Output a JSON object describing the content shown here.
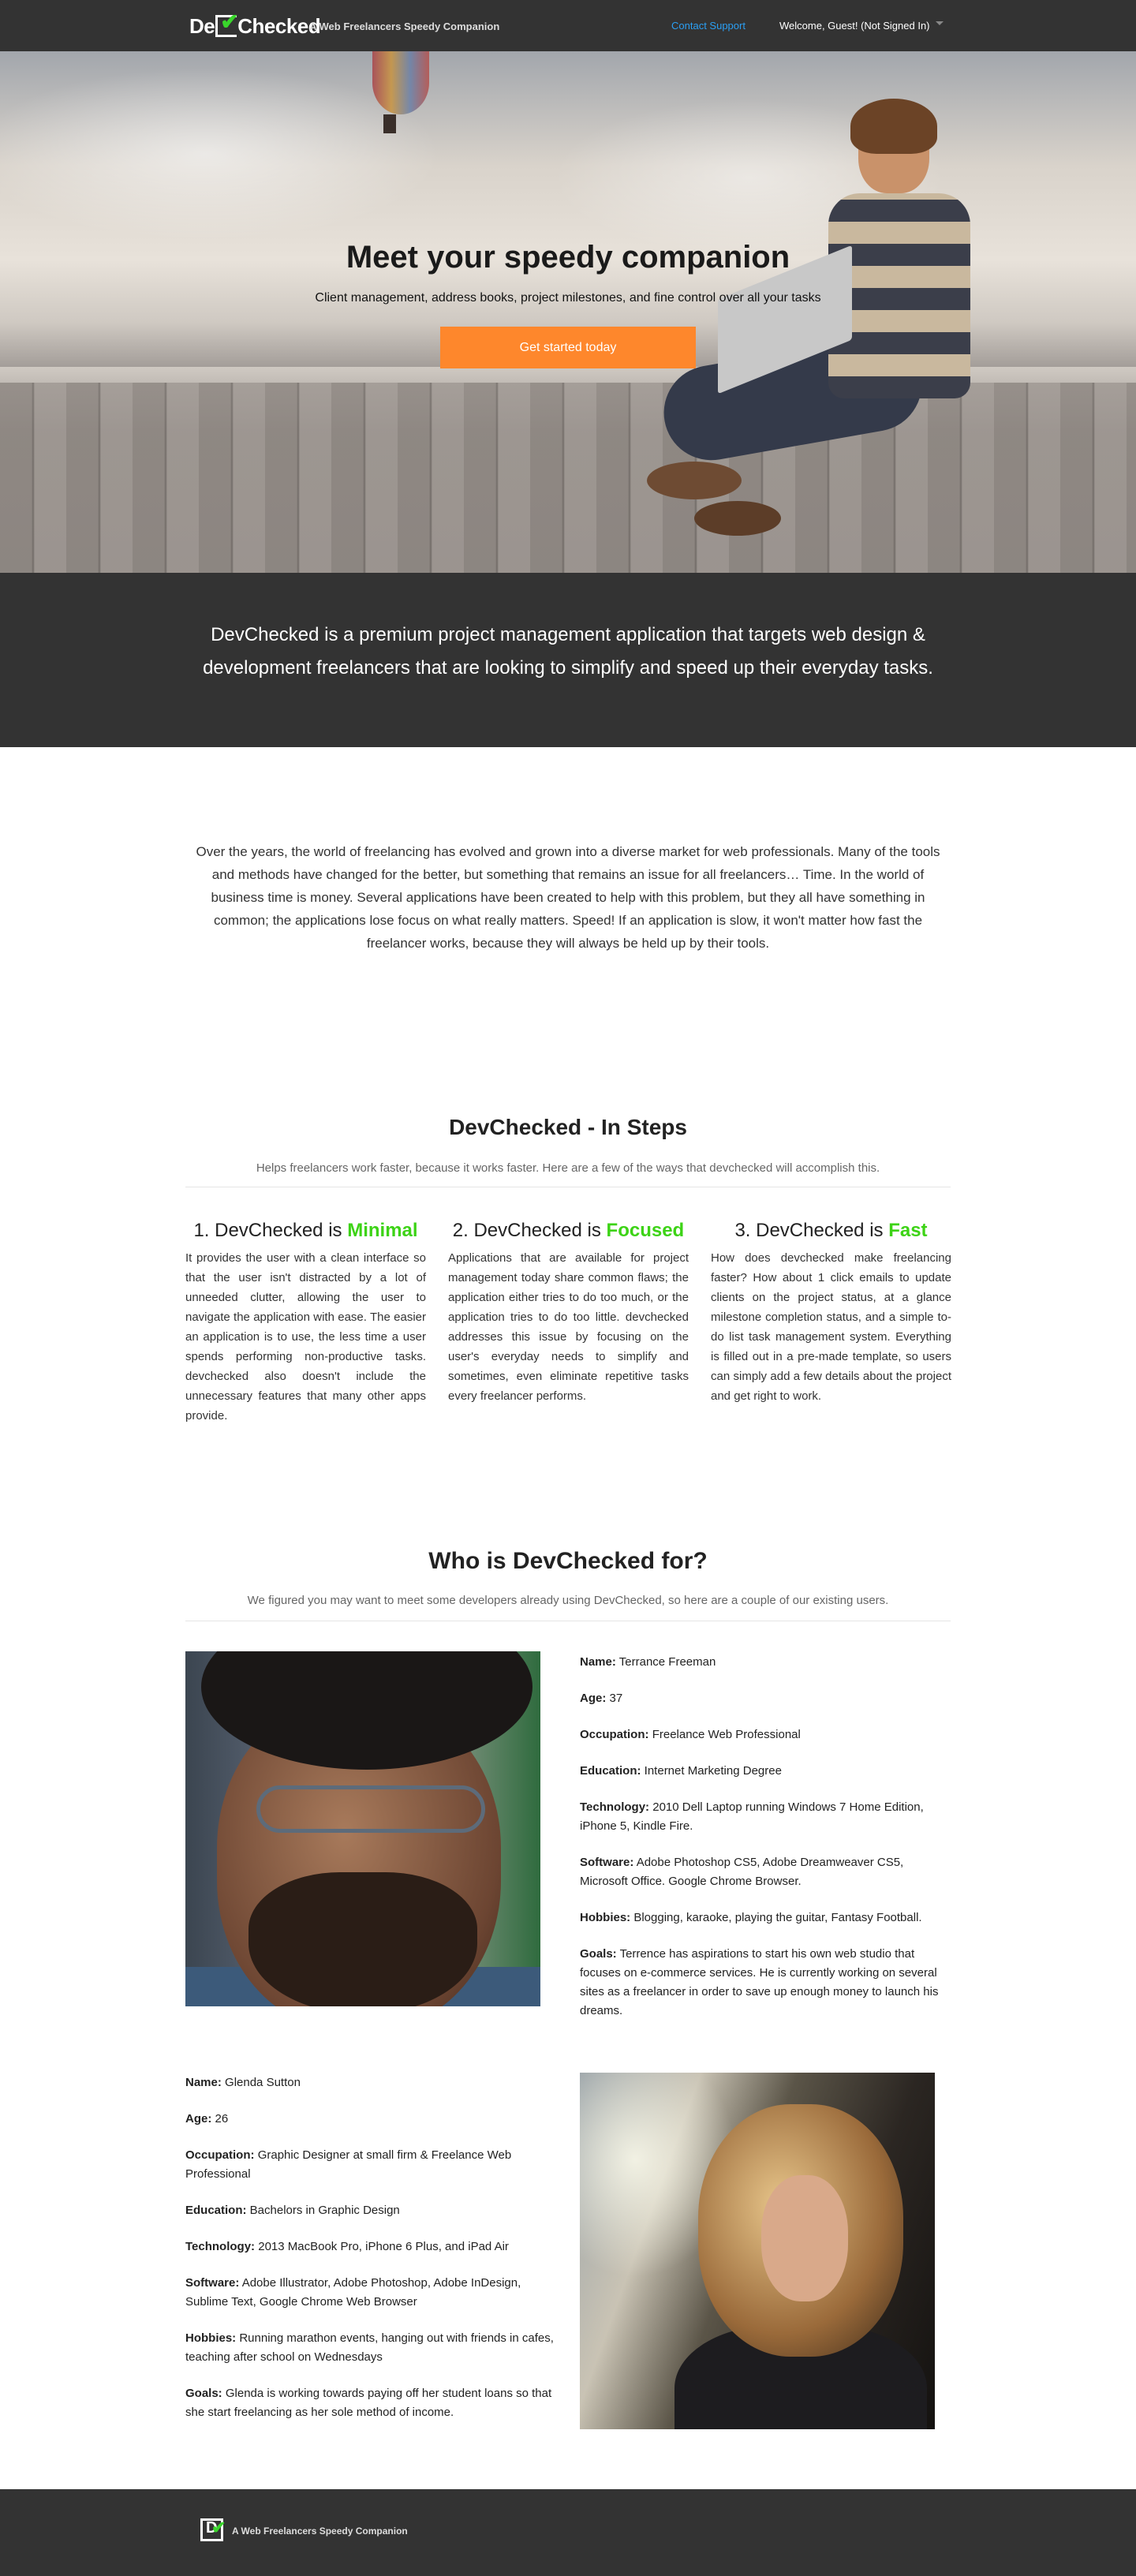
{
  "nav": {
    "logo_prefix": "De",
    "logo_check": "✔",
    "logo_suffix": "Checked",
    "tagline": "A Web Freelancers Speedy Companion",
    "support_link": "Contact Support",
    "user_menu": "Welcome, Guest! (Not Signed In)"
  },
  "hero": {
    "title": "Meet your speedy companion",
    "subtitle": "Client management, address books, project milestones, and fine control over all your tasks",
    "cta": "Get started today"
  },
  "statement": {
    "text": "DevChecked is a premium project management application that targets web design & development freelancers that are looking to simplify and speed up their everyday tasks."
  },
  "intro": {
    "text": "Over the years, the world of freelancing has evolved and grown into a diverse market for web professionals. Many of the tools and methods have changed for the better, but something that remains an issue for all freelancers… Time. In the world of business time is money. Several applications have been created to help with this problem, but they all have something in common; the applications lose focus on what really matters. Speed! If an application is slow, it won't matter how fast the freelancer works, because they will always be held up by their tools."
  },
  "steps": {
    "title": "DevChecked - In Steps",
    "subtitle": "Helps freelancers work faster, because it works faster. Here are a few of the ways that devchecked will accomplish this.",
    "items": [
      {
        "prefix": "1. DevChecked is ",
        "highlight": "Minimal",
        "text": "It provides the user with a clean interface so that the user isn't distracted by a lot of unneeded clutter, allowing the user to navigate the application with ease. The easier an application is to use, the less time a user spends performing non-productive tasks. devchecked also doesn't include the unnecessary features that many other apps provide."
      },
      {
        "prefix": "2. DevChecked is ",
        "highlight": "Focused",
        "text": "Applications that are available for project management today share common flaws; the application either tries to do too much, or the application tries to do too little. devchecked addresses this issue by focusing on the user's everyday needs to simplify and sometimes, even eliminate repetitive tasks every freelancer performs."
      },
      {
        "prefix": "3. DevChecked is ",
        "highlight": "Fast",
        "text": "How does devchecked make freelancing faster? How about 1 click emails to update clients on the project status, at a glance milestone completion status, and a simple to-do list task management system. Everything is filled out in a pre-made template, so users can simply add a few details about the project and get right to work."
      }
    ]
  },
  "who": {
    "title": "Who is DevChecked for?",
    "subtitle": "We figured you may want to meet some developers already using DevChecked, so here are a couple of our existing users.",
    "users": [
      {
        "name_label": "Name:",
        "name": "Terrance Freeman",
        "age_label": "Age:",
        "age": "37",
        "occupation_label": "Occupation:",
        "occupation": "Freelance Web Professional",
        "education_label": "Education:",
        "education": "Internet Marketing Degree",
        "technology_label": "Technology:",
        "technology": "2010 Dell Laptop running Windows 7 Home Edition, iPhone 5, Kindle Fire.",
        "software_label": "Software:",
        "software": "Adobe Photoshop CS5, Adobe Dreamweaver CS5, Microsoft Office. Google Chrome Browser.",
        "hobbies_label": "Hobbies:",
        "hobbies": "Blogging, karaoke, playing the guitar, Fantasy Football.",
        "goals_label": "Goals:",
        "goals": "Terrence has aspirations to start his own web studio that focuses on e-commerce services. He is currently working on several sites as a freelancer in order to save up enough money to launch his dreams."
      },
      {
        "name_label": "Name:",
        "name": "Glenda Sutton",
        "age_label": "Age:",
        "age": "26",
        "occupation_label": "Occupation:",
        "occupation": "Graphic Designer at small firm & Freelance Web Professional",
        "education_label": "Education:",
        "education": "Bachelors in Graphic Design",
        "technology_label": "Technology:",
        "technology": "2013 MacBook Pro, iPhone 6 Plus, and iPad Air",
        "software_label": "Software:",
        "software": "Adobe Illustrator, Adobe Photoshop, Adobe InDesign, Sublime Text, Google Chrome Web Browser",
        "hobbies_label": "Hobbies:",
        "hobbies": "Running marathon events, hanging out with friends in cafes, teaching after school on Wednesdays",
        "goals_label": "Goals:",
        "goals": "Glenda is working towards paying off her student loans so that she start freelancing as her sole method of income."
      }
    ]
  },
  "footer": {
    "logo_letter": "D",
    "logo_check": "✔",
    "tagline": "A Web Freelancers Speedy Companion"
  },
  "colors": {
    "accent_orange": "#fe872c",
    "highlight_green": "#3dd316",
    "link_blue": "#2b9ff3",
    "dark_bg": "#333333"
  }
}
